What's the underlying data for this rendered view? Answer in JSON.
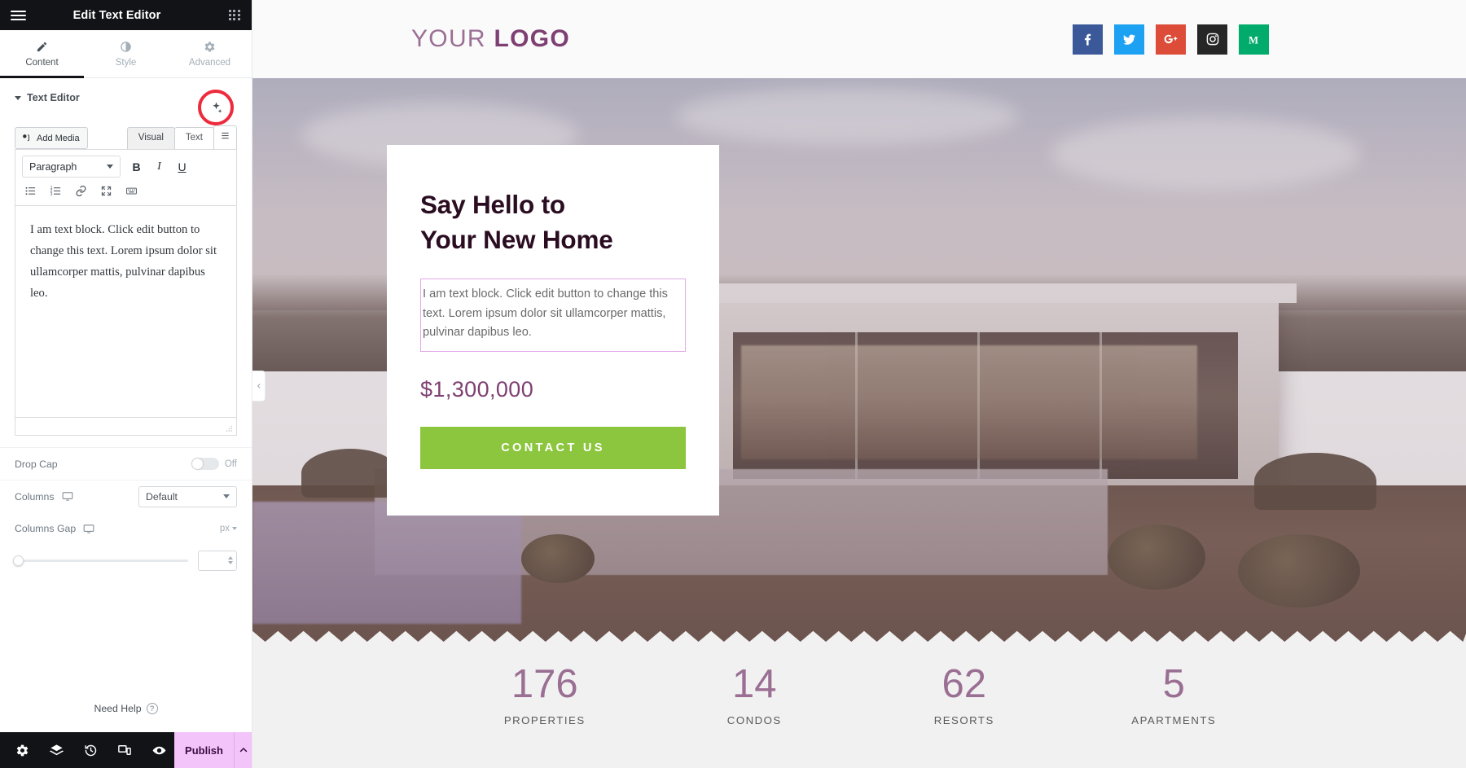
{
  "panel": {
    "header": {
      "title": "Edit Text Editor",
      "menu_icon": "hamburger-icon",
      "grid_icon": "apps-grid-icon"
    },
    "tabs": [
      {
        "label": "Content",
        "icon": "pencil-icon",
        "active": true
      },
      {
        "label": "Style",
        "icon": "contrast-circle-icon",
        "active": false
      },
      {
        "label": "Advanced",
        "icon": "gear-icon",
        "active": false
      }
    ],
    "section": {
      "title": "Text Editor",
      "caret_icon": "caret-down-icon"
    },
    "editor": {
      "ai_icon": "ai-sparkle-icon",
      "add_media": {
        "label": "Add Media",
        "icon": "add-media-icon"
      },
      "view_tabs": [
        {
          "label": "Visual",
          "active": true
        },
        {
          "label": "Text",
          "active": false
        }
      ],
      "extra_tab_icon": "list-view-icon",
      "format_select": {
        "value": "Paragraph"
      },
      "format_buttons": [
        {
          "label": "B",
          "name": "bold-button"
        },
        {
          "label": "I",
          "name": "italic-button"
        },
        {
          "label": "U",
          "name": "underline-button"
        }
      ],
      "tool_icons": [
        "bulleted-list-icon",
        "numbered-list-icon",
        "link-icon",
        "fullscreen-icon",
        "keyboard-shortcuts-icon"
      ],
      "content": "I am text block. Click edit button to change this text. Lorem ipsum dolor sit ullamcorper mattis, pulvinar dapibus leo.",
      "resize_handle_icon": "resize-grip-icon"
    },
    "controls": {
      "drop_cap": {
        "label": "Drop Cap",
        "state": "Off"
      },
      "columns": {
        "label": "Columns",
        "device_icon": "desktop-icon",
        "value": "Default"
      },
      "columns_gap": {
        "label": "Columns Gap",
        "device_icon": "desktop-icon",
        "unit": "px",
        "value": ""
      }
    },
    "need_help": {
      "label": "Need Help",
      "icon": "question-circle-icon"
    },
    "footer": {
      "icons": [
        "settings-gear-icon",
        "navigator-layers-icon",
        "history-clock-icon",
        "responsive-mode-icon",
        "preview-eye-icon"
      ],
      "publish_label": "Publish",
      "publish_caret_icon": "chevron-up-icon",
      "publish_color": "#f2c4f9"
    },
    "collapse_icon": "chevron-left-icon"
  },
  "canvas": {
    "header": {
      "logo_light": "YOUR ",
      "logo_bold": "LOGO",
      "socials": [
        {
          "name": "facebook-icon",
          "color": "#3b5998",
          "glyph": "f"
        },
        {
          "name": "twitter-icon",
          "color": "#1da1f2",
          "glyph": "t"
        },
        {
          "name": "google-plus-icon",
          "color": "#dd4b39",
          "glyph": "g+"
        },
        {
          "name": "instagram-icon",
          "color": "#262626",
          "glyph": "ig"
        },
        {
          "name": "medium-icon",
          "color": "#00ab6c",
          "glyph": "M"
        }
      ]
    },
    "hero_card": {
      "heading_line1": "Say Hello to",
      "heading_line2": "Your New Home",
      "body": "I am text block. Click edit button to change this text. Lorem ipsum dolor sit ullamcorper mattis, pulvinar dapibus leo.",
      "price": "$1,300,000",
      "cta_label": "CONTACT US",
      "cta_color": "#8cc63e",
      "selection_border_color": "#e3a8e8"
    },
    "stats": [
      {
        "number": "176",
        "label": "PROPERTIES"
      },
      {
        "number": "14",
        "label": "CONDOS"
      },
      {
        "number": "62",
        "label": "RESORTS"
      },
      {
        "number": "5",
        "label": "APARTMENTS"
      }
    ]
  }
}
